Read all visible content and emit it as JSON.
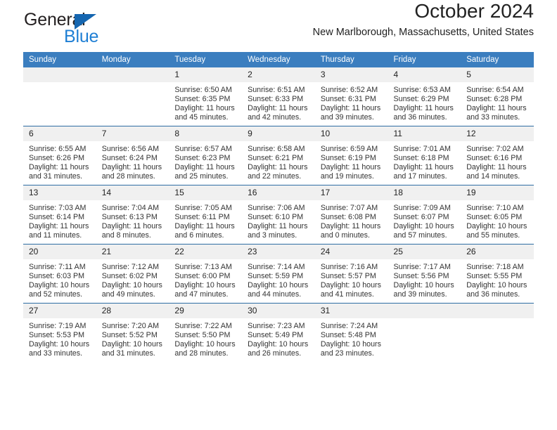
{
  "brand": {
    "name_top": "General",
    "name_bottom": "Blue",
    "accent_color": "#1f7fd4",
    "triangle_color": "#1566b0"
  },
  "header": {
    "title": "October 2024",
    "subtitle": "New Marlborough, Massachusetts, United States",
    "header_bg_color": "#3b7ebf",
    "row_border_color": "#2e6da4",
    "daynum_bg_color": "#f0f0f0"
  },
  "calendar": {
    "weekday_headers": [
      "Sunday",
      "Monday",
      "Tuesday",
      "Wednesday",
      "Thursday",
      "Friday",
      "Saturday"
    ],
    "weeks": [
      [
        {
          "day": ""
        },
        {
          "day": ""
        },
        {
          "day": "1",
          "sunrise": "Sunrise: 6:50 AM",
          "sunset": "Sunset: 6:35 PM",
          "daylight_1": "Daylight: 11 hours",
          "daylight_2": "and 45 minutes."
        },
        {
          "day": "2",
          "sunrise": "Sunrise: 6:51 AM",
          "sunset": "Sunset: 6:33 PM",
          "daylight_1": "Daylight: 11 hours",
          "daylight_2": "and 42 minutes."
        },
        {
          "day": "3",
          "sunrise": "Sunrise: 6:52 AM",
          "sunset": "Sunset: 6:31 PM",
          "daylight_1": "Daylight: 11 hours",
          "daylight_2": "and 39 minutes."
        },
        {
          "day": "4",
          "sunrise": "Sunrise: 6:53 AM",
          "sunset": "Sunset: 6:29 PM",
          "daylight_1": "Daylight: 11 hours",
          "daylight_2": "and 36 minutes."
        },
        {
          "day": "5",
          "sunrise": "Sunrise: 6:54 AM",
          "sunset": "Sunset: 6:28 PM",
          "daylight_1": "Daylight: 11 hours",
          "daylight_2": "and 33 minutes."
        }
      ],
      [
        {
          "day": "6",
          "sunrise": "Sunrise: 6:55 AM",
          "sunset": "Sunset: 6:26 PM",
          "daylight_1": "Daylight: 11 hours",
          "daylight_2": "and 31 minutes."
        },
        {
          "day": "7",
          "sunrise": "Sunrise: 6:56 AM",
          "sunset": "Sunset: 6:24 PM",
          "daylight_1": "Daylight: 11 hours",
          "daylight_2": "and 28 minutes."
        },
        {
          "day": "8",
          "sunrise": "Sunrise: 6:57 AM",
          "sunset": "Sunset: 6:23 PM",
          "daylight_1": "Daylight: 11 hours",
          "daylight_2": "and 25 minutes."
        },
        {
          "day": "9",
          "sunrise": "Sunrise: 6:58 AM",
          "sunset": "Sunset: 6:21 PM",
          "daylight_1": "Daylight: 11 hours",
          "daylight_2": "and 22 minutes."
        },
        {
          "day": "10",
          "sunrise": "Sunrise: 6:59 AM",
          "sunset": "Sunset: 6:19 PM",
          "daylight_1": "Daylight: 11 hours",
          "daylight_2": "and 19 minutes."
        },
        {
          "day": "11",
          "sunrise": "Sunrise: 7:01 AM",
          "sunset": "Sunset: 6:18 PM",
          "daylight_1": "Daylight: 11 hours",
          "daylight_2": "and 17 minutes."
        },
        {
          "day": "12",
          "sunrise": "Sunrise: 7:02 AM",
          "sunset": "Sunset: 6:16 PM",
          "daylight_1": "Daylight: 11 hours",
          "daylight_2": "and 14 minutes."
        }
      ],
      [
        {
          "day": "13",
          "sunrise": "Sunrise: 7:03 AM",
          "sunset": "Sunset: 6:14 PM",
          "daylight_1": "Daylight: 11 hours",
          "daylight_2": "and 11 minutes."
        },
        {
          "day": "14",
          "sunrise": "Sunrise: 7:04 AM",
          "sunset": "Sunset: 6:13 PM",
          "daylight_1": "Daylight: 11 hours",
          "daylight_2": "and 8 minutes."
        },
        {
          "day": "15",
          "sunrise": "Sunrise: 7:05 AM",
          "sunset": "Sunset: 6:11 PM",
          "daylight_1": "Daylight: 11 hours",
          "daylight_2": "and 6 minutes."
        },
        {
          "day": "16",
          "sunrise": "Sunrise: 7:06 AM",
          "sunset": "Sunset: 6:10 PM",
          "daylight_1": "Daylight: 11 hours",
          "daylight_2": "and 3 minutes."
        },
        {
          "day": "17",
          "sunrise": "Sunrise: 7:07 AM",
          "sunset": "Sunset: 6:08 PM",
          "daylight_1": "Daylight: 11 hours",
          "daylight_2": "and 0 minutes."
        },
        {
          "day": "18",
          "sunrise": "Sunrise: 7:09 AM",
          "sunset": "Sunset: 6:07 PM",
          "daylight_1": "Daylight: 10 hours",
          "daylight_2": "and 57 minutes."
        },
        {
          "day": "19",
          "sunrise": "Sunrise: 7:10 AM",
          "sunset": "Sunset: 6:05 PM",
          "daylight_1": "Daylight: 10 hours",
          "daylight_2": "and 55 minutes."
        }
      ],
      [
        {
          "day": "20",
          "sunrise": "Sunrise: 7:11 AM",
          "sunset": "Sunset: 6:03 PM",
          "daylight_1": "Daylight: 10 hours",
          "daylight_2": "and 52 minutes."
        },
        {
          "day": "21",
          "sunrise": "Sunrise: 7:12 AM",
          "sunset": "Sunset: 6:02 PM",
          "daylight_1": "Daylight: 10 hours",
          "daylight_2": "and 49 minutes."
        },
        {
          "day": "22",
          "sunrise": "Sunrise: 7:13 AM",
          "sunset": "Sunset: 6:00 PM",
          "daylight_1": "Daylight: 10 hours",
          "daylight_2": "and 47 minutes."
        },
        {
          "day": "23",
          "sunrise": "Sunrise: 7:14 AM",
          "sunset": "Sunset: 5:59 PM",
          "daylight_1": "Daylight: 10 hours",
          "daylight_2": "and 44 minutes."
        },
        {
          "day": "24",
          "sunrise": "Sunrise: 7:16 AM",
          "sunset": "Sunset: 5:57 PM",
          "daylight_1": "Daylight: 10 hours",
          "daylight_2": "and 41 minutes."
        },
        {
          "day": "25",
          "sunrise": "Sunrise: 7:17 AM",
          "sunset": "Sunset: 5:56 PM",
          "daylight_1": "Daylight: 10 hours",
          "daylight_2": "and 39 minutes."
        },
        {
          "day": "26",
          "sunrise": "Sunrise: 7:18 AM",
          "sunset": "Sunset: 5:55 PM",
          "daylight_1": "Daylight: 10 hours",
          "daylight_2": "and 36 minutes."
        }
      ],
      [
        {
          "day": "27",
          "sunrise": "Sunrise: 7:19 AM",
          "sunset": "Sunset: 5:53 PM",
          "daylight_1": "Daylight: 10 hours",
          "daylight_2": "and 33 minutes."
        },
        {
          "day": "28",
          "sunrise": "Sunrise: 7:20 AM",
          "sunset": "Sunset: 5:52 PM",
          "daylight_1": "Daylight: 10 hours",
          "daylight_2": "and 31 minutes."
        },
        {
          "day": "29",
          "sunrise": "Sunrise: 7:22 AM",
          "sunset": "Sunset: 5:50 PM",
          "daylight_1": "Daylight: 10 hours",
          "daylight_2": "and 28 minutes."
        },
        {
          "day": "30",
          "sunrise": "Sunrise: 7:23 AM",
          "sunset": "Sunset: 5:49 PM",
          "daylight_1": "Daylight: 10 hours",
          "daylight_2": "and 26 minutes."
        },
        {
          "day": "31",
          "sunrise": "Sunrise: 7:24 AM",
          "sunset": "Sunset: 5:48 PM",
          "daylight_1": "Daylight: 10 hours",
          "daylight_2": "and 23 minutes."
        },
        {
          "day": ""
        },
        {
          "day": ""
        }
      ]
    ]
  }
}
